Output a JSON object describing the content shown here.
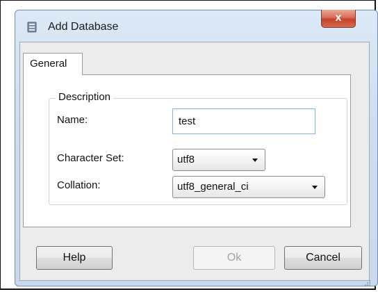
{
  "dialog": {
    "title": "Add Database",
    "close_glyph": "x"
  },
  "tabs": [
    {
      "label": "General",
      "selected": true
    }
  ],
  "description_group": {
    "legend": "Description",
    "name_label": "Name:",
    "name_value": "test",
    "charset_label": "Character Set:",
    "charset_value": "utf8",
    "collation_label": "Collation:",
    "collation_value": "utf8_general_ci"
  },
  "buttons": {
    "help": "Help",
    "ok": "Ok",
    "cancel": "Cancel"
  },
  "icons": {
    "title": "database-icon",
    "close": "close-icon",
    "dropdown": "chevron-down-icon",
    "grip": "resize-grip-icon"
  },
  "colors": {
    "title_bar": "#cfdeee",
    "close_button": "#c7422a",
    "input_focus_border": "#7eb4ea",
    "disabled_text": "#a3a3a3"
  }
}
